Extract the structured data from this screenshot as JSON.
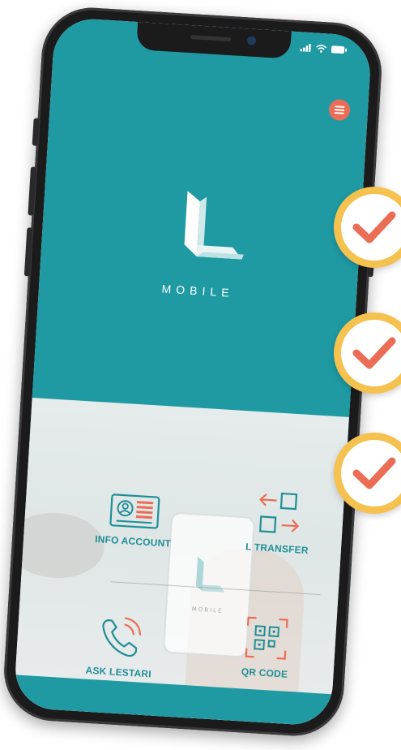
{
  "app": {
    "brand": "MOBILE",
    "logo_letter": "L"
  },
  "status_bar": {
    "icons": [
      "signal-icon",
      "wifi-icon",
      "battery-icon"
    ]
  },
  "header": {
    "menu_icon": "hamburger-menu-icon"
  },
  "features": [
    {
      "label": "INFO ACCOUNT",
      "icon": "id-card-icon"
    },
    {
      "label": "L TRANSFER",
      "icon": "transfer-arrows-icon"
    },
    {
      "label": "ASK LESTARI",
      "icon": "phone-call-icon"
    },
    {
      "label": "QR CODE",
      "icon": "qr-scan-icon"
    }
  ],
  "background_phone": {
    "brand": "MOBILE"
  },
  "badges": [
    {
      "icon": "checkmark-icon"
    },
    {
      "icon": "checkmark-icon"
    },
    {
      "icon": "checkmark-icon"
    }
  ],
  "colors": {
    "teal": "#1f9aa3",
    "accent_red": "#ec6d55",
    "badge_ring": "#f5c14f",
    "check": "#ec6d55",
    "label": "#1f8f97"
  }
}
